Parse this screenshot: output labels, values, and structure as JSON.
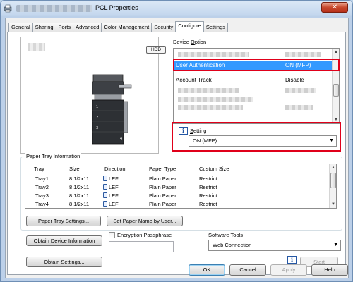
{
  "window": {
    "title_suffix": "PCL Properties",
    "close_symbol": "✕"
  },
  "tabs": [
    "General",
    "Sharing",
    "Ports",
    "Advanced",
    "Color Management",
    "Security",
    "Configure",
    "Settings"
  ],
  "active_tab": "Configure",
  "preview": {
    "hdd_badge": "HDD",
    "tray_numbers": [
      "1",
      "2",
      "3",
      "4"
    ]
  },
  "device_option": {
    "label": "Device Option",
    "label_mnemonic": "O",
    "rows": [
      {
        "name": "User Authentication",
        "value": "ON (MFP)",
        "selected": true
      },
      {
        "name": "Account Track",
        "value": "Disable",
        "selected": false
      }
    ]
  },
  "setting": {
    "label": "Setting",
    "label_mnemonic": "S",
    "value": "ON (MFP)"
  },
  "paper_tray": {
    "group_title": "Paper Tray Information",
    "columns": [
      "Tray",
      "Size",
      "Direction",
      "Paper Type",
      "Custom Size"
    ],
    "rows": [
      {
        "tray": "Tray1",
        "size": "8 1/2x11",
        "direction": "LEF",
        "paper_type": "Plain Paper",
        "custom_size": "Restrict"
      },
      {
        "tray": "Tray2",
        "size": "8 1/2x11",
        "direction": "LEF",
        "paper_type": "Plain Paper",
        "custom_size": "Restrict"
      },
      {
        "tray": "Tray3",
        "size": "8 1/2x11",
        "direction": "LEF",
        "paper_type": "Plain Paper",
        "custom_size": "Restrict"
      },
      {
        "tray": "Tray4",
        "size": "8 1/2x11",
        "direction": "LEF",
        "paper_type": "Plain Paper",
        "custom_size": "Restrict"
      }
    ],
    "settings_button": "Paper Tray Settings...",
    "set_name_button": "Set Paper Name by User..."
  },
  "obtain_device_info_button": "Obtain Device Information",
  "encryption_passphrase_label": "Encryption Passphrase",
  "obtain_settings_button": "Obtain Settings...",
  "software_tools": {
    "label": "Software Tools",
    "value": "Web Connection",
    "start_button": "Start"
  },
  "dialog_buttons": {
    "ok": "OK",
    "cancel": "Cancel",
    "apply": "Apply",
    "help": "Help"
  },
  "colors": {
    "selection": "#3399ff",
    "highlight_box": "#e0001a"
  }
}
